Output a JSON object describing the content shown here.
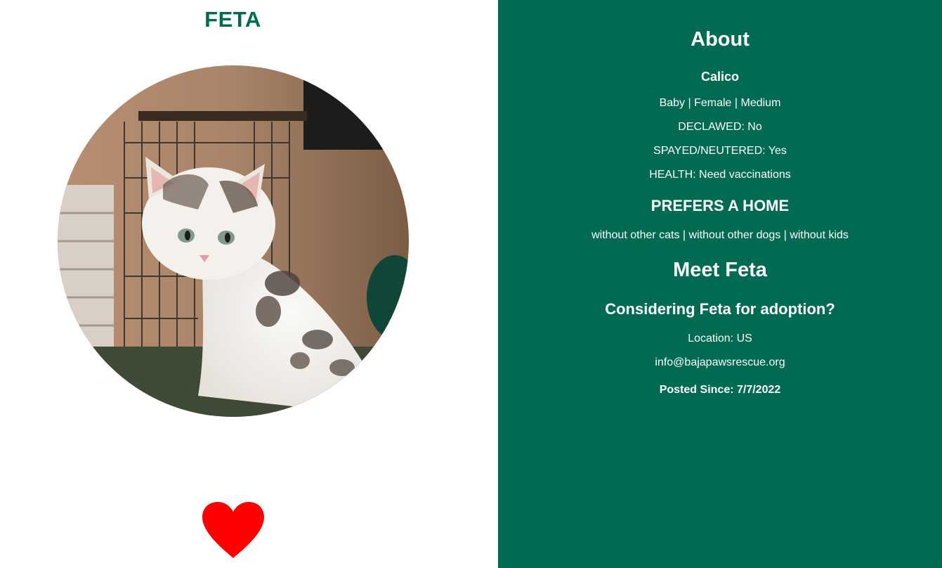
{
  "pet": {
    "name": "FETA",
    "photo_icon": "kitten-photo"
  },
  "favorite": {
    "icon": "heart-icon",
    "color": "#ff0000"
  },
  "about": {
    "heading": "About",
    "breed": "Calico",
    "attributes": "Baby | Female | Medium",
    "declawed": "DECLAWED: No",
    "spayed": "SPAYED/NEUTERED: Yes",
    "health": "HEALTH: Need vaccinations",
    "prefers_heading": "PREFERS A HOME",
    "prefers": "without other cats | without other dogs | without kids",
    "meet_heading": "Meet Feta",
    "consider_heading": "Considering Feta for adoption?",
    "location": "Location: US",
    "email": "info@bajapawsrescue.org",
    "posted": "Posted Since: 7/7/2022"
  },
  "colors": {
    "brand_green": "#006a52",
    "white": "#ffffff",
    "heart": "#ff0000"
  }
}
